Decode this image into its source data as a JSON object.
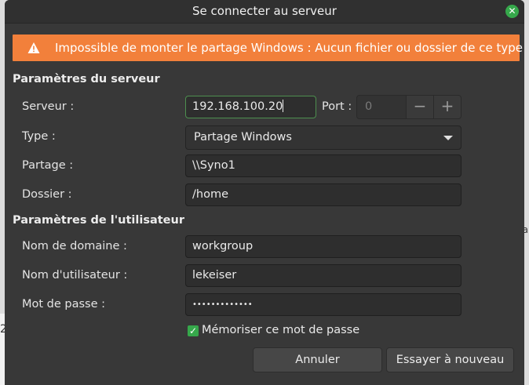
{
  "background": {
    "left_glyph": "2",
    "right_glyph": "a"
  },
  "window": {
    "title": "Se connecter au serveur"
  },
  "banner": {
    "message": "Impossible de monter le partage Windows : Aucun fichier ou dossier de ce type",
    "color": "#f2803b"
  },
  "server_section": {
    "heading": "Paramètres du serveur",
    "server_label": "Serveur :",
    "server_value": "192.168.100.20",
    "port_label": "Port :",
    "port_value": "0",
    "type_label": "Type :",
    "type_value": "Partage Windows",
    "share_label": "Partage :",
    "share_value": "\\\\Syno1",
    "folder_label": "Dossier :",
    "folder_value": "/home"
  },
  "user_section": {
    "heading": "Paramètres de l'utilisateur",
    "domain_label": "Nom de domaine :",
    "domain_value": "workgroup",
    "username_label": "Nom d'utilisateur :",
    "username_value": "lekeiser",
    "password_label": "Mot de passe :",
    "password_value": "•••••••••••••",
    "remember_label": "Mémoriser ce mot de passe",
    "remember_checked": true
  },
  "buttons": {
    "cancel": "Annuler",
    "retry": "Essayer à nouveau"
  },
  "icons": {
    "close": "close-icon",
    "warning": "warning-icon",
    "minus": "minus-icon",
    "plus": "plus-icon",
    "dropdown": "chevron-down-icon",
    "check": "check-icon"
  },
  "colors": {
    "accent": "#36a84b",
    "dialog_bg": "#383838"
  }
}
